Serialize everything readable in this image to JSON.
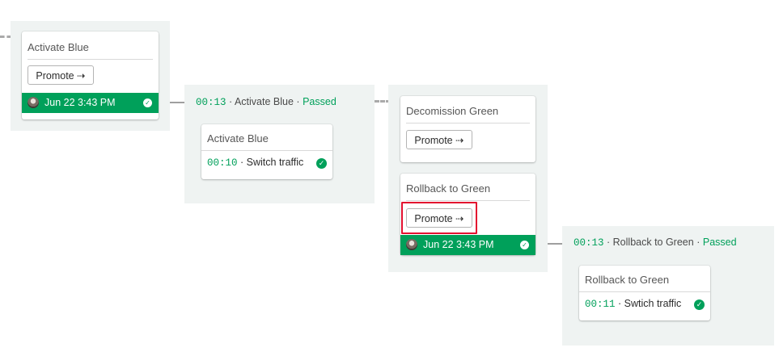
{
  "pipeline": {
    "promotion_label": "Promote ⇢",
    "blocks": [
      {
        "title": "Activate Blue",
        "run": {
          "date": "Jun 22 3:43 PM"
        }
      },
      {
        "status": {
          "duration": "00:13",
          "name": "Activate Blue",
          "result": "Passed"
        },
        "job": {
          "title": "Activate Blue",
          "duration": "00:10",
          "name": "Switch traffic"
        }
      },
      {
        "decomission": {
          "title": "Decomission Green"
        },
        "rollback": {
          "title": "Rollback to Green",
          "run": {
            "date": "Jun 22 3:43 PM"
          }
        }
      },
      {
        "status": {
          "duration": "00:13",
          "name": "Rollback to Green",
          "result": "Passed"
        },
        "job": {
          "title": "Rollback to Green",
          "duration": "00:11",
          "name": "Swtich traffic"
        }
      }
    ]
  },
  "separator": "·",
  "colors": {
    "success": "#00a05a",
    "highlight": "#e3102f",
    "panel": "#eff3f2"
  }
}
